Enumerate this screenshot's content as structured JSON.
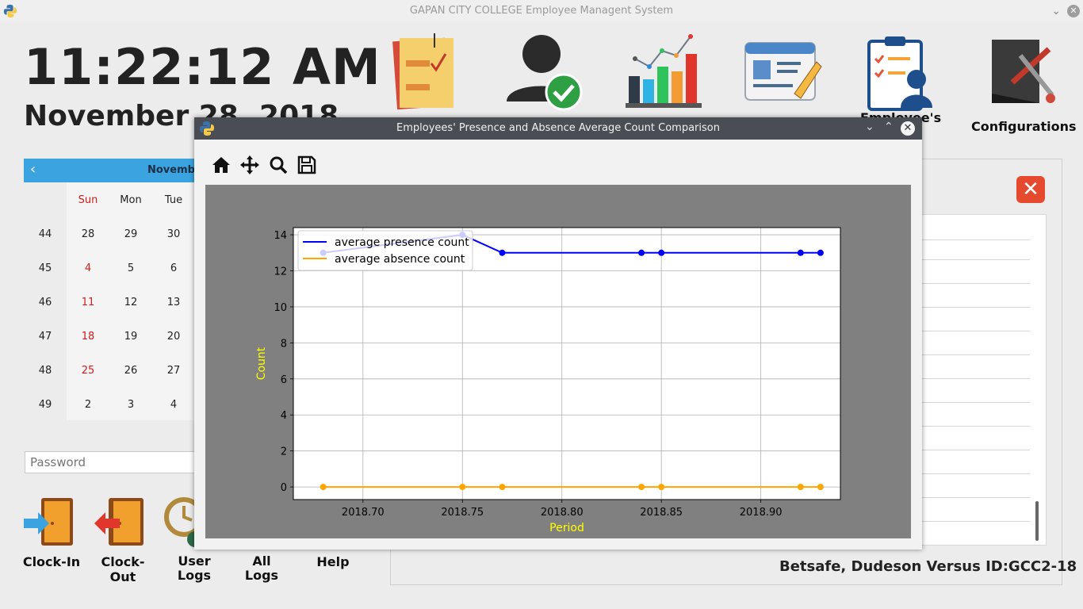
{
  "app": {
    "title": "GAPAN CITY COLLEGE Employee Managent System",
    "clock": "11:22:12 AM",
    "date": "November 28, 2018"
  },
  "tiles": [
    {
      "label": "",
      "icon": "notes-checklist-icon"
    },
    {
      "label": "",
      "icon": "user-verified-icon"
    },
    {
      "label": "",
      "icon": "bar-chart-icon"
    },
    {
      "label": "",
      "icon": "id-card-pencil-icon"
    },
    {
      "label": "Employee's\non\ns",
      "icon": "clipboard-user-icon"
    },
    {
      "label": "Configurations",
      "icon": "configurations-icon"
    }
  ],
  "calendar": {
    "month_label": "Novembe",
    "day_headers": [
      "Sun",
      "Mon",
      "Tue"
    ],
    "weeks": [
      {
        "week": "44",
        "days": [
          "28",
          "29",
          "30"
        ]
      },
      {
        "week": "45",
        "days": [
          "4",
          "5",
          "6"
        ]
      },
      {
        "week": "46",
        "days": [
          "11",
          "12",
          "13"
        ]
      },
      {
        "week": "47",
        "days": [
          "18",
          "19",
          "20"
        ]
      },
      {
        "week": "48",
        "days": [
          "25",
          "26",
          "27"
        ]
      },
      {
        "week": "49",
        "days": [
          "2",
          "3",
          "4"
        ]
      }
    ]
  },
  "login": {
    "password_placeholder": "Password"
  },
  "actions": {
    "clock_in": "Clock-In",
    "clock_out": "Clock-Out",
    "user_logs_1": "User",
    "user_logs_2": "Logs",
    "all_logs_1": "All",
    "all_logs_2": "Logs",
    "help": "Help"
  },
  "panel": {
    "employee": "Betsafe, Dudeson Versus  ID:GCC2-18",
    "close_glyph": "✕"
  },
  "figure_window": {
    "title": "Employees' Presence and Absence Average Count Comparison",
    "toolbar": [
      "home-icon",
      "pan-icon",
      "zoom-icon",
      "save-icon"
    ]
  },
  "chart_data": {
    "type": "line",
    "xlabel": "Period",
    "ylabel": "Count",
    "xlim": [
      2018.665,
      2018.94
    ],
    "ylim": [
      -0.7,
      14.4
    ],
    "xticks": [
      "2018.70",
      "2018.75",
      "2018.80",
      "2018.85",
      "2018.90"
    ],
    "xtick_values": [
      2018.7,
      2018.75,
      2018.8,
      2018.85,
      2018.9
    ],
    "yticks": [
      "0",
      "2",
      "4",
      "6",
      "8",
      "10",
      "12",
      "14"
    ],
    "ytick_values": [
      0,
      2,
      4,
      6,
      8,
      10,
      12,
      14
    ],
    "grid": true,
    "legend_position": "upper-left",
    "series": [
      {
        "name": "average presence count",
        "color": "#0000ff",
        "x": [
          2018.68,
          2018.75,
          2018.77,
          2018.84,
          2018.85,
          2018.92,
          2018.93
        ],
        "y": [
          13,
          14,
          13,
          13,
          13,
          13,
          13
        ]
      },
      {
        "name": "average absence count",
        "color": "#ffa500",
        "x": [
          2018.68,
          2018.75,
          2018.77,
          2018.84,
          2018.85,
          2018.92,
          2018.93
        ],
        "y": [
          0,
          0,
          0,
          0,
          0,
          0,
          0
        ]
      }
    ],
    "label_color": "#ffff00"
  }
}
